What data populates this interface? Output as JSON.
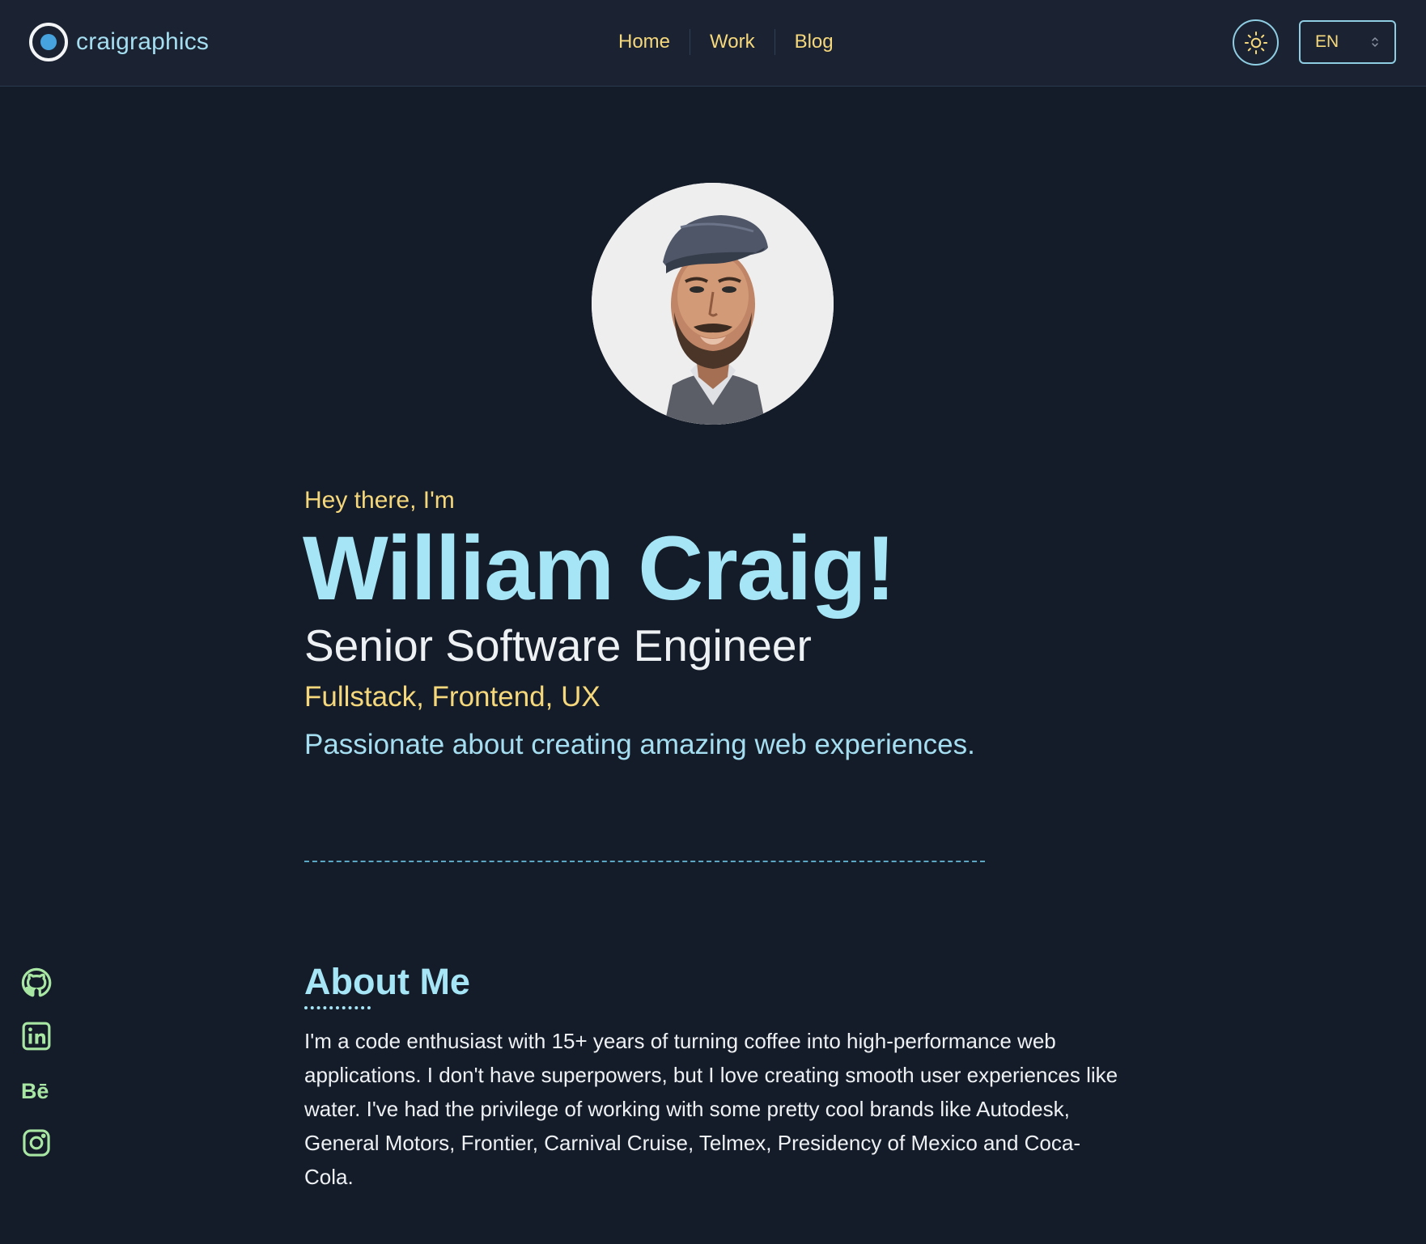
{
  "header": {
    "brand": "craigraphics",
    "nav": [
      {
        "label": "Home"
      },
      {
        "label": "Work"
      },
      {
        "label": "Blog"
      }
    ],
    "language": {
      "selected": "EN"
    },
    "theme_toggle_icon": "sun-icon"
  },
  "hero": {
    "greeting": "Hey there, I'm",
    "name": "William Craig!",
    "role": "Senior Software Engineer",
    "skills": "Fullstack, Frontend, UX",
    "tagline": "Passionate about creating amazing web experiences."
  },
  "about": {
    "title": "About Me",
    "text": "I'm a code enthusiast with 15+ years of turning coffee into high-performance web applications. I don't have superpowers, but I love creating smooth user experiences like water. I've had the privilege of working with some pretty cool brands like Autodesk, General Motors, Frontier, Carnival Cruise, Telmex, Presidency of Mexico and Coca-Cola."
  },
  "social": [
    {
      "icon": "github-icon"
    },
    {
      "icon": "linkedin-icon"
    },
    {
      "icon": "behance-icon"
    },
    {
      "icon": "instagram-icon"
    }
  ],
  "colors": {
    "background": "#151c29",
    "header_bg": "#1b2332",
    "accent_cyan": "#a5e5f5",
    "accent_yellow": "#f6d87c",
    "social_green": "#a8e6a3"
  }
}
